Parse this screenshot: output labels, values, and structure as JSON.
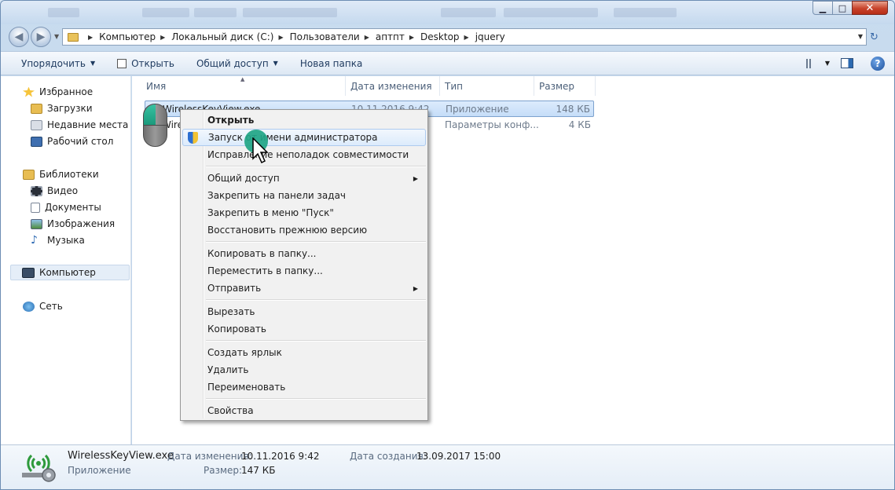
{
  "window": {
    "minimize_glyph": "▁",
    "maximize_glyph": "□",
    "close_glyph": "✕"
  },
  "address": {
    "crumbs": [
      "Компьютер",
      "Локальный диск (C:)",
      "Пользователи",
      "aптпт",
      "Desktop",
      "jquery"
    ],
    "refresh_glyph": "↻"
  },
  "toolbar": {
    "organize_label": "Упорядочить",
    "open_label": "Открыть",
    "share_label": "Общий доступ",
    "new_folder_label": "Новая папка",
    "help_glyph": "?"
  },
  "navpane": {
    "favorites": "Избранное",
    "downloads": "Загрузки",
    "recent": "Недавние места",
    "desktop": "Рабочий стол",
    "libraries": "Библиотеки",
    "video": "Видео",
    "documents": "Документы",
    "images": "Изображения",
    "music": "Музыка",
    "computer": "Компьютер",
    "network": "Сеть"
  },
  "columns": {
    "name": "Имя",
    "date": "Дата изменения",
    "type": "Тип",
    "size": "Размер"
  },
  "files": [
    {
      "name": "WirelessKeyView.exe",
      "date": "10.11.2016 9:42",
      "type": "Приложение",
      "size": "148 КБ"
    },
    {
      "name": "WirelessKeyView.cfg",
      "date": "",
      "type": "Параметры конф...",
      "size": "4 КБ"
    }
  ],
  "context_menu": {
    "open": "Открыть",
    "run_as_admin": "Запуск от имени администратора",
    "troubleshoot": "Исправление неполадок совместимости",
    "share": "Общий доступ",
    "pin_taskbar": "Закрепить на панели задач",
    "pin_start": "Закрепить в меню \"Пуск\"",
    "restore": "Восстановить прежнюю версию",
    "copy_to": "Копировать в папку...",
    "move_to": "Переместить в папку...",
    "send_to": "Отправить",
    "cut": "Вырезать",
    "copy": "Копировать",
    "shortcut": "Создать ярлык",
    "delete": "Удалить",
    "rename": "Переименовать",
    "properties": "Свойства",
    "submenu_glyph": "▶"
  },
  "details": {
    "filename": "WirelessKeyView.exe",
    "type": "Приложение",
    "modified_label": "Дата изменения:",
    "modified_value": "10.11.2016 9:42",
    "created_label": "Дата создания:",
    "created_value": "13.09.2017 15:00",
    "size_label": "Размер:",
    "size_value": "147 КБ"
  }
}
